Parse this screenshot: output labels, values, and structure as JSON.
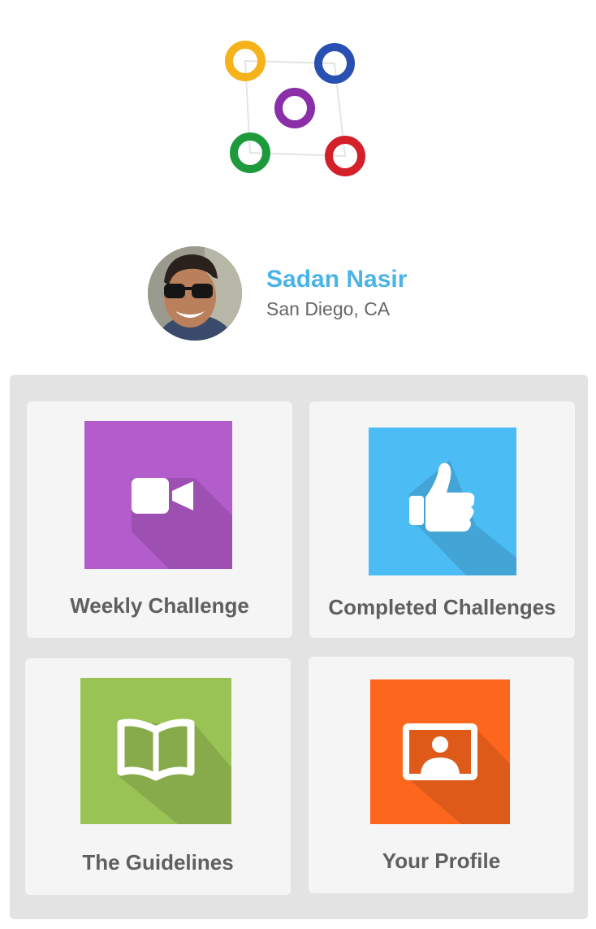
{
  "logo": {
    "icon": "app-logo-rings",
    "colors": [
      "#f5b21a",
      "#2a4fb3",
      "#8a2fa8",
      "#1e9a3c",
      "#d3202a"
    ]
  },
  "user": {
    "name": "Sadan Nasir",
    "location": "San Diego, CA",
    "avatar_icon": "user-avatar-photo",
    "name_color": "#4ab4e6"
  },
  "menu": {
    "tiles": [
      {
        "label": "Weekly Challenge",
        "icon": "video-camera-icon",
        "color": "#b35ccb"
      },
      {
        "label": "Completed Challenges",
        "icon": "thumbs-up-icon",
        "color": "#4cbcf4"
      },
      {
        "label": "The Guidelines",
        "icon": "open-book-icon",
        "color": "#9ac355"
      },
      {
        "label": "Your Profile",
        "icon": "profile-card-icon",
        "color": "#fd671d"
      }
    ]
  }
}
